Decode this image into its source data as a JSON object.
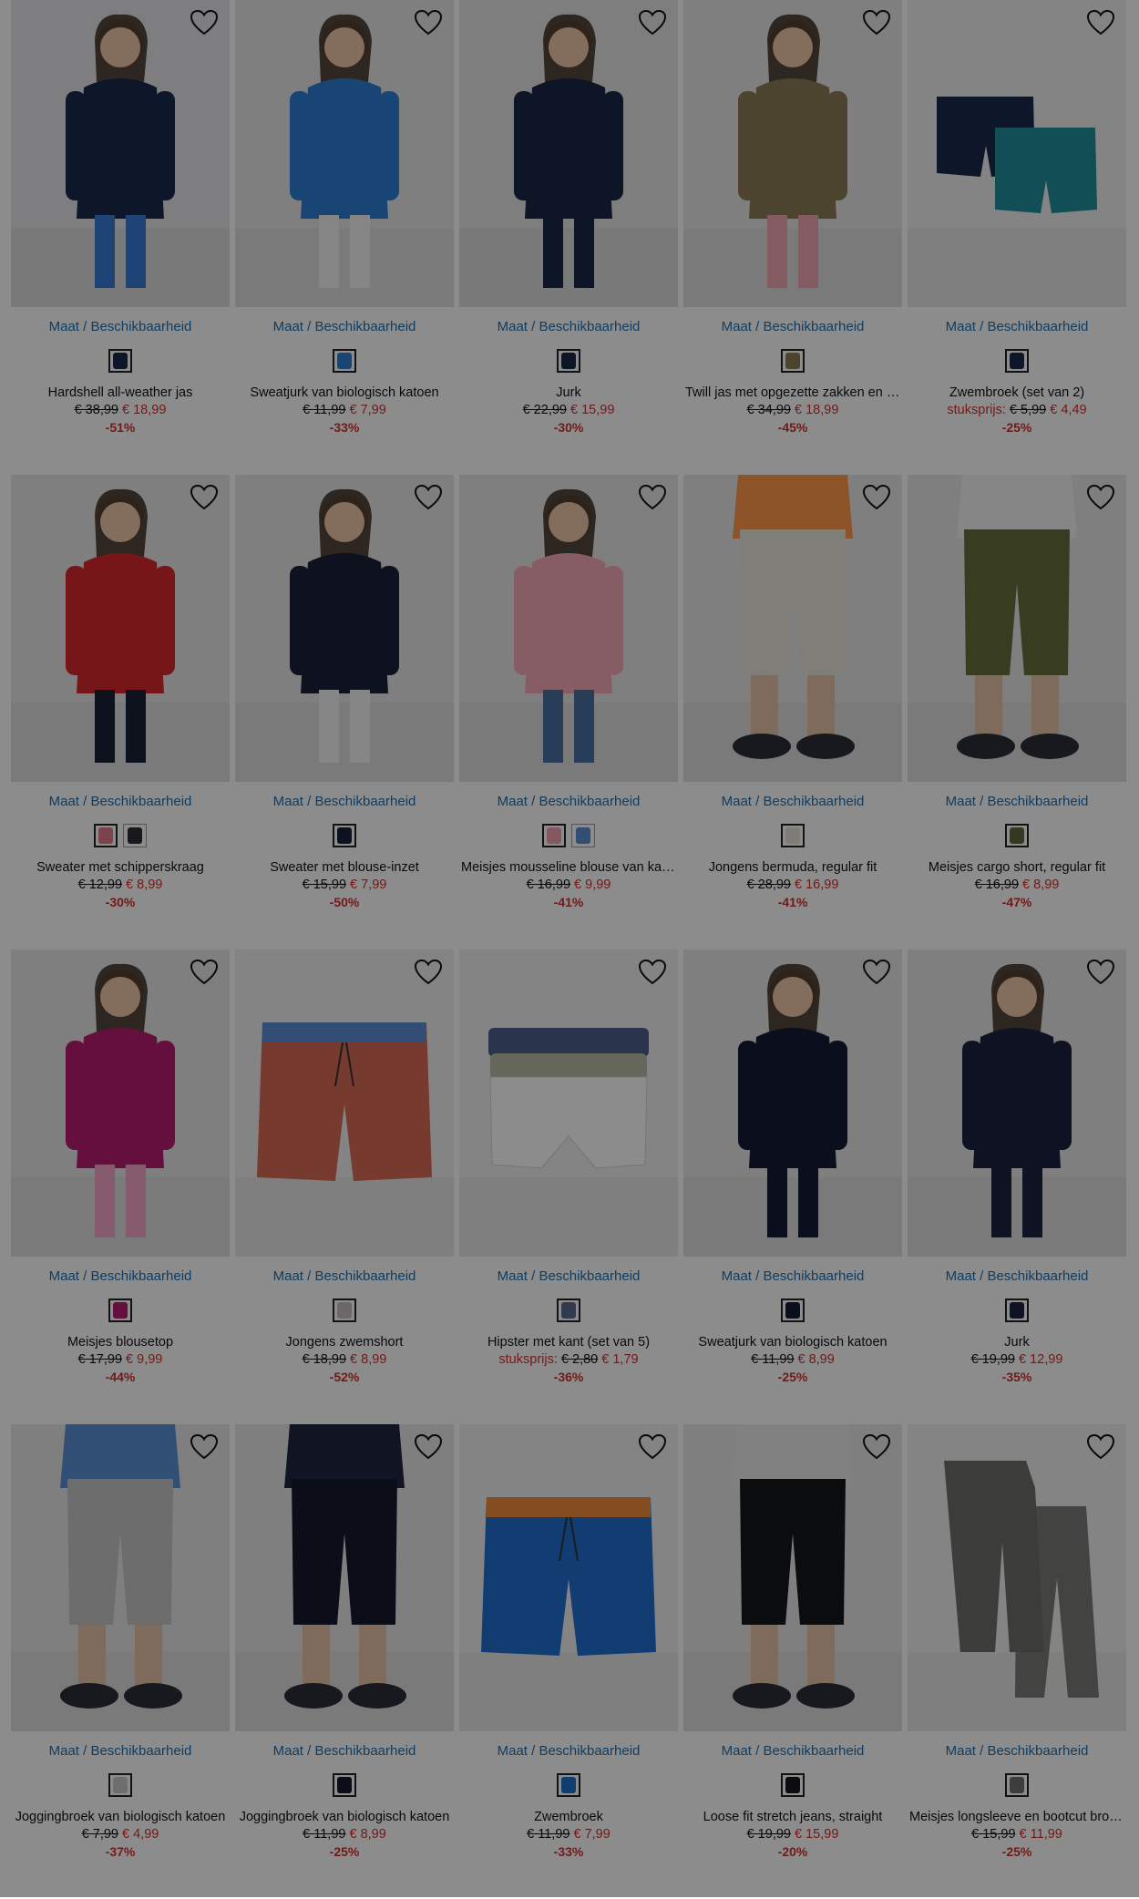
{
  "size_label": "Maat / Beschikbaarheid",
  "unit_label": "stuksprijs:",
  "products": [
    {
      "title": "Hardshell all-weather jas",
      "old": "€ 38,99",
      "new": "€ 18,99",
      "discount": "-51%",
      "unit": false,
      "colors": [
        "#1b2a4e"
      ],
      "bg": "#e6e6e9",
      "fig": "#1b2a4e",
      "fig2": "#3a7bd5",
      "type": "person"
    },
    {
      "title": "Sweatjurk van biologisch katoen",
      "old": "€ 11,99",
      "new": "€ 7,99",
      "discount": "-33%",
      "unit": false,
      "colors": [
        "#2f7fd6"
      ],
      "bg": "#e8e8ea",
      "fig": "#2f7fd6",
      "fig2": "#f2f2f2",
      "type": "person"
    },
    {
      "title": "Jurk",
      "old": "€ 22,99",
      "new": "€ 15,99",
      "discount": "-30%",
      "unit": false,
      "colors": [
        "#1a2747"
      ],
      "bg": "#e6e6e8",
      "fig": "#1a2747",
      "fig2": "#1a2747",
      "type": "person"
    },
    {
      "title": "Twill jas met opgezette zakken en capuchon",
      "old": "€ 34,99",
      "new": "€ 18,99",
      "discount": "-45%",
      "unit": false,
      "colors": [
        "#8a7d52"
      ],
      "bg": "#e8e8ea",
      "fig": "#8b7d55",
      "fig2": "#f1a6b2",
      "type": "person"
    },
    {
      "title": "Zwembroek (set van 2)",
      "old": "€ 5,99",
      "new": "€ 4,49",
      "discount": "-25%",
      "unit": true,
      "colors": [
        "#1b2a4e"
      ],
      "bg": "#f1f1f2",
      "fig": "#1b2a4e",
      "fig2": "#1f8e9b",
      "type": "shorts2"
    },
    {
      "title": "Sweater met schipperskraag",
      "old": "€ 12,99",
      "new": "€ 8,99",
      "discount": "-30%",
      "unit": false,
      "colors": [
        "#e07a8a",
        "#2a2f3a"
      ],
      "bg": "#e8e8ea",
      "fig": "#d9282f",
      "fig2": "#1b2233",
      "type": "person"
    },
    {
      "title": "Sweater met blouse-inzet",
      "old": "€ 15,99",
      "new": "€ 7,99",
      "discount": "-50%",
      "unit": false,
      "colors": [
        "#1a2037"
      ],
      "bg": "#e8e8ea",
      "fig": "#1a2037",
      "fig2": "#f4f4f4",
      "type": "person"
    },
    {
      "title": "Meisjes mousseline blouse van katoen",
      "old": "€ 16,99",
      "new": "€ 9,99",
      "discount": "-41%",
      "unit": false,
      "colors": [
        "#f2a1b0",
        "#5b8fd6"
      ],
      "bg": "#e8e8ea",
      "fig": "#f6a9b8",
      "fig2": "#4a6fa0",
      "type": "person"
    },
    {
      "title": "Jongens bermuda, regular fit",
      "old": "€ 28,99",
      "new": "€ 16,99",
      "discount": "-41%",
      "unit": false,
      "colors": [
        "#e6e3d6"
      ],
      "bg": "#e8e8ea",
      "fig": "#ff9a4a",
      "fig2": "#e9e6da",
      "type": "legs"
    },
    {
      "title": "Meisjes cargo short, regular fit",
      "old": "€ 16,99",
      "new": "€ 8,99",
      "discount": "-47%",
      "unit": false,
      "colors": [
        "#5f6b3a"
      ],
      "bg": "#e8e8ea",
      "fig": "#f5f5f5",
      "fig2": "#66703f",
      "type": "legs"
    },
    {
      "title": "Meisjes blousetop",
      "old": "€ 17,99",
      "new": "€ 9,99",
      "discount": "-44%",
      "unit": false,
      "colors": [
        "#b3206f"
      ],
      "bg": "#e8e8ea",
      "fig": "#b91c72",
      "fig2": "#f4a6c6",
      "type": "person"
    },
    {
      "title": "Jongens zwemshort",
      "old": "€ 18,99",
      "new": "€ 8,99",
      "discount": "-52%",
      "unit": false,
      "colors": [
        "#c8bcbc"
      ],
      "bg": "#f1f1f2",
      "fig": "#d76a55",
      "fig2": "#5d8fd3",
      "type": "shorts"
    },
    {
      "title": "Hipster met kant (set van 5)",
      "old": "€ 2,80",
      "new": "€ 1,79",
      "discount": "-36%",
      "unit": true,
      "colors": [
        "#5a6a8f"
      ],
      "bg": "#f1f1f2",
      "fig": "#4d5f8c",
      "fig2": "#ffffff",
      "type": "briefs"
    },
    {
      "title": "Sweatjurk van biologisch katoen",
      "old": "€ 11,99",
      "new": "€ 8,99",
      "discount": "-25%",
      "unit": false,
      "colors": [
        "#141b33"
      ],
      "bg": "#e8e8ea",
      "fig": "#141b33",
      "fig2": "#141b33",
      "type": "person"
    },
    {
      "title": "Jurk",
      "old": "€ 19,99",
      "new": "€ 12,99",
      "discount": "-35%",
      "unit": false,
      "colors": [
        "#1b2240"
      ],
      "bg": "#e8e8ea",
      "fig": "#1b2240",
      "fig2": "#1b2240",
      "type": "person"
    },
    {
      "title": "Joggingbroek van biologisch katoen",
      "old": "€ 7,99",
      "new": "€ 4,99",
      "discount": "-37%",
      "unit": false,
      "colors": [
        "#c9c9c9"
      ],
      "bg": "#e8e8ea",
      "fig": "#5b93d8",
      "fig2": "#c7c7c7",
      "type": "legs"
    },
    {
      "title": "Joggingbroek van biologisch katoen",
      "old": "€ 11,99",
      "new": "€ 8,99",
      "discount": "-25%",
      "unit": false,
      "colors": [
        "#151a2c"
      ],
      "bg": "#e8e8ea",
      "fig": "#1f2740",
      "fig2": "#151a2c",
      "type": "legs"
    },
    {
      "title": "Zwembroek",
      "old": "€ 11,99",
      "new": "€ 7,99",
      "discount": "-33%",
      "unit": false,
      "colors": [
        "#1e6fd0"
      ],
      "bg": "#f1f1f2",
      "fig": "#1f6fd1",
      "fig2": "#f08a3a",
      "type": "shorts"
    },
    {
      "title": "Loose fit stretch jeans, straight",
      "old": "€ 19,99",
      "new": "€ 15,99",
      "discount": "-20%",
      "unit": false,
      "colors": [
        "#16171b"
      ],
      "bg": "#e8e8ea",
      "fig": "#ececec",
      "fig2": "#15161a",
      "type": "legs"
    },
    {
      "title": "Meisjes longsleeve en bootcut broek van ribstof",
      "old": "€ 15,99",
      "new": "€ 11,99",
      "discount": "-25%",
      "unit": false,
      "colors": [
        "#6f6f6f"
      ],
      "bg": "#f1f1f2",
      "fig": "#6e6e6c",
      "fig2": "#6e6e6c",
      "type": "set"
    }
  ]
}
